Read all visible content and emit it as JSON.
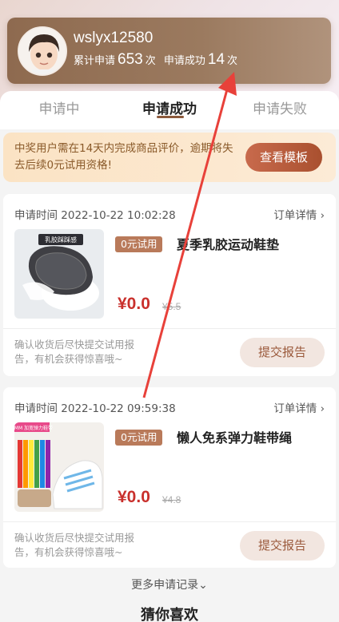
{
  "user": {
    "name": "wslyx12580",
    "applied_label": "累计申请",
    "applied_count": "653",
    "applied_unit": "次",
    "success_label": "申请成功",
    "success_count": "14",
    "success_unit": "次"
  },
  "tabs": [
    {
      "label": "申请中",
      "active": false
    },
    {
      "label": "申请成功",
      "active": true
    },
    {
      "label": "申请失败",
      "active": false
    }
  ],
  "notice": {
    "text": "中奖用户需在14天内完成商品评价，逾期将失去后续0元试用资格!",
    "button": "查看模板"
  },
  "orders": [
    {
      "time": "申请时间 2022-10-22 10:02:28",
      "detail": "订单详情 ›",
      "badge": "0元试用",
      "name": "夏季乳胶运动鞋垫",
      "price": "¥0.0",
      "old_price": "¥5.5",
      "tip": "确认收货后尽快提交试用报告，有机会获得惊喜哦~",
      "button": "提交报告"
    },
    {
      "time": "申请时间 2022-10-22 09:59:38",
      "detail": "订单详情 ›",
      "badge": "0元试用",
      "name": "懒人免系弹力鞋带绳",
      "price": "¥0.0",
      "old_price": "¥4.8",
      "tip": "确认收货后尽快提交试用报告，有机会获得惊喜哦~",
      "button": "提交报告"
    }
  ],
  "product_image_texts": [
    "乳胶踩踩感",
    "8MM 加宽弹力鞋带"
  ],
  "more_records": "更多申请记录⌄",
  "guess_title": "猜你喜欢",
  "colors": {
    "accent": "#8c5a3c",
    "price": "#c9302c",
    "annotation_arrow": "#e8413a"
  }
}
